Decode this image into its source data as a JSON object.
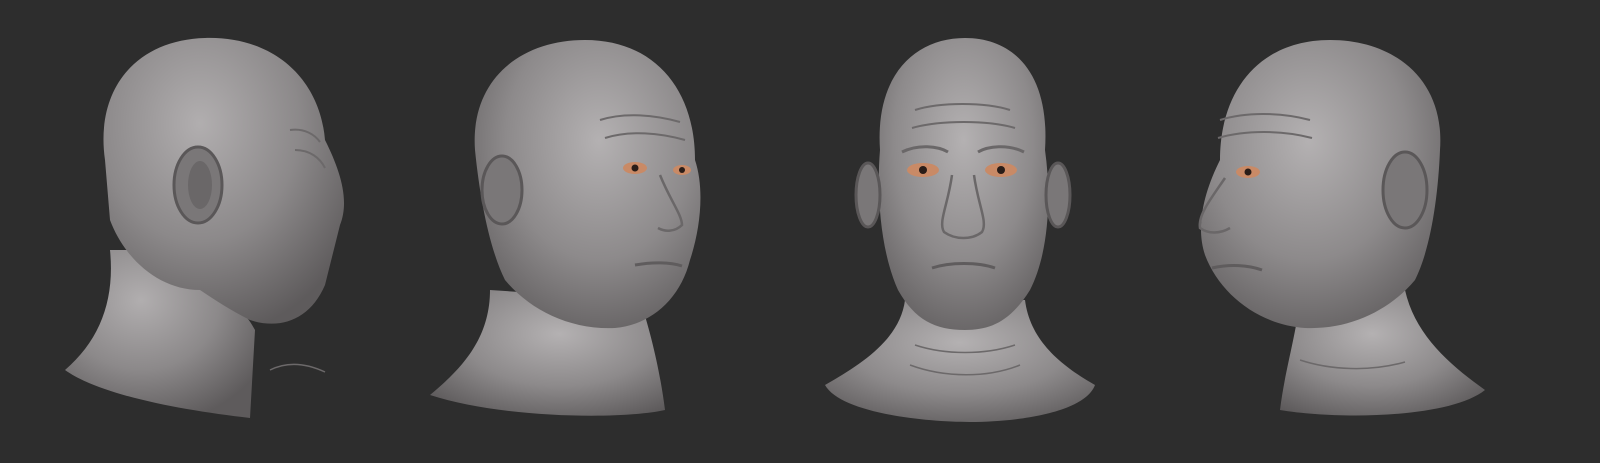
{
  "scene": {
    "background_color": "#2d2d2d",
    "clay_color": "#8a8788",
    "eye_color": "#c98a66",
    "views": [
      {
        "id": "profile-right",
        "icon": "head-profile-right"
      },
      {
        "id": "three-quarter-right",
        "icon": "head-three-quarter-right"
      },
      {
        "id": "front",
        "icon": "head-front"
      },
      {
        "id": "three-quarter-left",
        "icon": "head-three-quarter-left"
      }
    ]
  }
}
